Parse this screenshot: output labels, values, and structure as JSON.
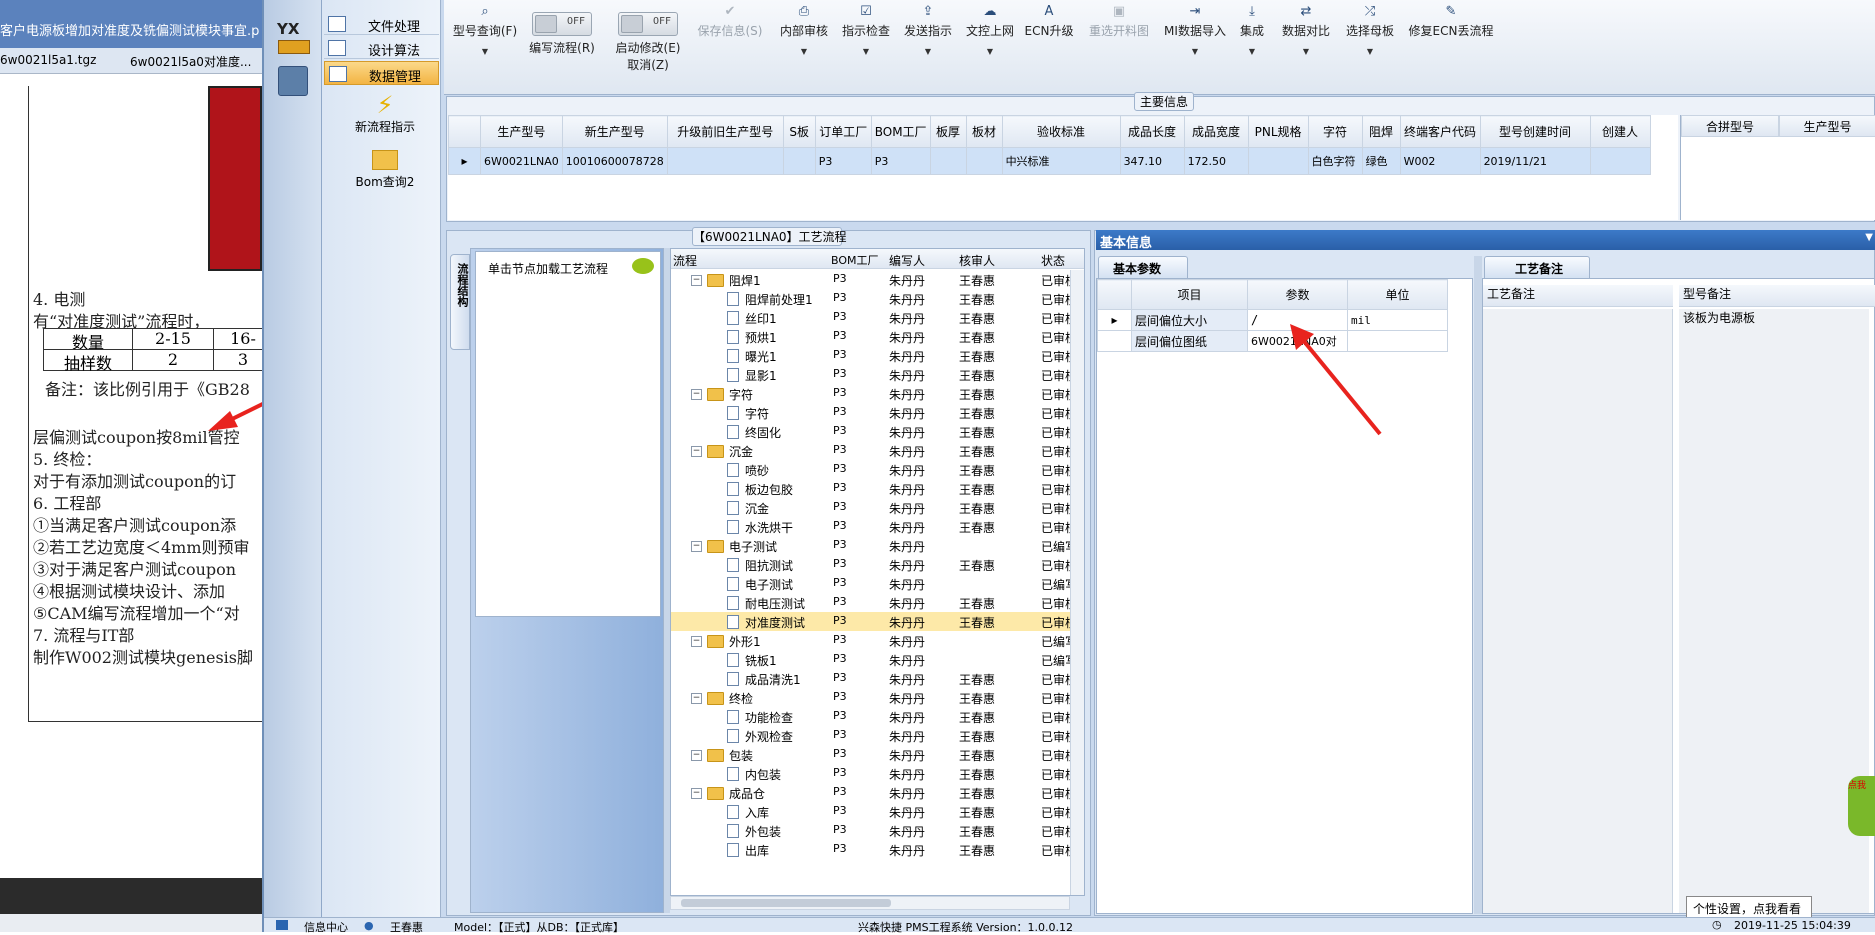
{
  "background_doc": {
    "title": "客户电源板增加对准度及铣偏测试模块事宜.p",
    "tabs": [
      "6w0021l5a1.tgz",
      "6w0021l5a0对准度..."
    ],
    "lines": [
      "4. 电测",
      "有“对准度测试”流程时，",
      "备注：该比例引用于《GB28",
      "层偏测试coupon按8mil管控",
      "5. 终检：",
      "对于有添加测试coupon的订",
      "6. 工程部",
      "①当满足客户测试coupon添",
      "②若工艺边宽度＜4mm则预审",
      "③对于满足客户测试coupon",
      "④根据测试模块设计、添加",
      "⑤CAM编写流程增加一个“对",
      "7. 流程与IT部",
      "制作W002测试模块genesis脚"
    ],
    "table": {
      "row1": [
        "数量",
        "2-15",
        "16-"
      ],
      "row2": [
        "抽样数",
        "2",
        "3"
      ]
    }
  },
  "nav": {
    "logo": "YX",
    "menu": [
      "文件处理",
      "设计算法",
      "数据管理"
    ],
    "actions": [
      "新流程指示",
      "Bom查询2"
    ]
  },
  "toolbar": {
    "buttons": [
      {
        "label": "型号查询(F)",
        "icon": "search-icon",
        "icon_glyph": "⌕",
        "disabled": false,
        "dropdown": true
      },
      {
        "label": "编写流程(R)",
        "icon": "toggle",
        "toggle_text": "OFF",
        "disabled": false,
        "dropdown": false
      },
      {
        "label": "启动修改(E)",
        "label2": "取消(Z)",
        "icon": "toggle",
        "toggle_text": "OFF",
        "disabled": false,
        "dropdown": false
      },
      {
        "label": "保存信息(S)",
        "icon": "check-icon",
        "icon_glyph": "✔",
        "disabled": true,
        "dropdown": false
      },
      {
        "label": "内部审核",
        "icon": "printer-icon",
        "icon_glyph": "⎙",
        "disabled": false,
        "dropdown": true
      },
      {
        "label": "指示检查",
        "icon": "checkbox-icon",
        "icon_glyph": "☑",
        "disabled": false,
        "dropdown": true
      },
      {
        "label": "发送指示",
        "icon": "upload-icon",
        "icon_glyph": "⇪",
        "disabled": false,
        "dropdown": true
      },
      {
        "label": "文控上网",
        "icon": "cloud-upload-icon",
        "icon_glyph": "☁",
        "disabled": false,
        "dropdown": true
      },
      {
        "label": "ECN升级",
        "icon": "font-icon",
        "icon_glyph": "A",
        "disabled": false,
        "dropdown": false
      },
      {
        "label": "重选开料图",
        "icon": "image-icon",
        "icon_glyph": "▣",
        "disabled": true,
        "dropdown": false
      },
      {
        "label": "MI数据导入",
        "icon": "import-icon",
        "icon_glyph": "⇥",
        "disabled": false,
        "dropdown": true
      },
      {
        "label": "集成",
        "icon": "download-icon",
        "icon_glyph": "⤓",
        "disabled": false,
        "dropdown": true
      },
      {
        "label": "数据对比",
        "icon": "compare-icon",
        "icon_glyph": "⇄",
        "disabled": false,
        "dropdown": true
      },
      {
        "label": "选择母板",
        "icon": "shuffle-icon",
        "icon_glyph": "⤮",
        "disabled": false,
        "dropdown": true
      },
      {
        "label": "修复ECN丢流程",
        "icon": "wrench-icon",
        "icon_glyph": "✎",
        "disabled": false,
        "dropdown": false
      }
    ]
  },
  "main_info": {
    "title": "主要信息",
    "columns": [
      "生产型号",
      "新生产型号",
      "升级前旧生产型号",
      "S板",
      "订单工厂",
      "BOM工厂",
      "板厚",
      "板材",
      "验收标准",
      "成品长度",
      "成品宽度",
      "PNL规格",
      "字符",
      "阻焊",
      "终端客户代码",
      "型号创建时间",
      "创建人"
    ],
    "row": [
      "6W0021LNA0",
      "10010600078728",
      "",
      "",
      "P3",
      "P3",
      "",
      "",
      "中兴标准",
      "347.10",
      "172.50",
      "",
      "白色字符",
      "绿色",
      "W002",
      "2019/11/21",
      ""
    ],
    "side_columns": [
      "合拼型号",
      "生产型号"
    ]
  },
  "flow_panel": {
    "title": "【6W0021LNA0】工艺流程",
    "side_tab": "流程结构",
    "load_hint": "单击节点加载工艺流程",
    "columns": [
      "流程",
      "BOM工厂",
      "编写人",
      "核审人",
      "状态"
    ],
    "rows": [
      {
        "level": 0,
        "name": "阻焊1",
        "bom": "P3",
        "writer": "朱丹丹",
        "reviewer": "王春惠",
        "status": "已审核"
      },
      {
        "level": 1,
        "name": "阻焊前处理1",
        "bom": "P3",
        "writer": "朱丹丹",
        "reviewer": "王春惠",
        "status": "已审核"
      },
      {
        "level": 1,
        "name": "丝印1",
        "bom": "P3",
        "writer": "朱丹丹",
        "reviewer": "王春惠",
        "status": "已审核"
      },
      {
        "level": 1,
        "name": "预烘1",
        "bom": "P3",
        "writer": "朱丹丹",
        "reviewer": "王春惠",
        "status": "已审核"
      },
      {
        "level": 1,
        "name": "曝光1",
        "bom": "P3",
        "writer": "朱丹丹",
        "reviewer": "王春惠",
        "status": "已审核"
      },
      {
        "level": 1,
        "name": "显影1",
        "bom": "P3",
        "writer": "朱丹丹",
        "reviewer": "王春惠",
        "status": "已审核"
      },
      {
        "level": 0,
        "name": "字符",
        "bom": "P3",
        "writer": "朱丹丹",
        "reviewer": "王春惠",
        "status": "已审核"
      },
      {
        "level": 1,
        "name": "字符",
        "bom": "P3",
        "writer": "朱丹丹",
        "reviewer": "王春惠",
        "status": "已审核"
      },
      {
        "level": 1,
        "name": "终固化",
        "bom": "P3",
        "writer": "朱丹丹",
        "reviewer": "王春惠",
        "status": "已审核"
      },
      {
        "level": 0,
        "name": "沉金",
        "bom": "P3",
        "writer": "朱丹丹",
        "reviewer": "王春惠",
        "status": "已审核"
      },
      {
        "level": 1,
        "name": "喷砂",
        "bom": "P3",
        "writer": "朱丹丹",
        "reviewer": "王春惠",
        "status": "已审核"
      },
      {
        "level": 1,
        "name": "板边包胶",
        "bom": "P3",
        "writer": "朱丹丹",
        "reviewer": "王春惠",
        "status": "已审核"
      },
      {
        "level": 1,
        "name": "沉金",
        "bom": "P3",
        "writer": "朱丹丹",
        "reviewer": "王春惠",
        "status": "已审核"
      },
      {
        "level": 1,
        "name": "水洗烘干",
        "bom": "P3",
        "writer": "朱丹丹",
        "reviewer": "王春惠",
        "status": "已审核"
      },
      {
        "level": 0,
        "name": "电子测试",
        "bom": "P3",
        "writer": "朱丹丹",
        "reviewer": "",
        "status": "已编写"
      },
      {
        "level": 1,
        "name": "阻抗测试",
        "bom": "P3",
        "writer": "朱丹丹",
        "reviewer": "王春惠",
        "status": "已审核"
      },
      {
        "level": 1,
        "name": "电子测试",
        "bom": "P3",
        "writer": "朱丹丹",
        "reviewer": "",
        "status": "已编写"
      },
      {
        "level": 1,
        "name": "耐电压测试",
        "bom": "P3",
        "writer": "朱丹丹",
        "reviewer": "王春惠",
        "status": "已审核"
      },
      {
        "level": 1,
        "name": "对准度测试",
        "bom": "P3",
        "writer": "朱丹丹",
        "reviewer": "王春惠",
        "status": "已审核",
        "highlight": true
      },
      {
        "level": 0,
        "name": "外形1",
        "bom": "P3",
        "writer": "朱丹丹",
        "reviewer": "",
        "status": "已编写"
      },
      {
        "level": 1,
        "name": "铣板1",
        "bom": "P3",
        "writer": "朱丹丹",
        "reviewer": "",
        "status": "已编写"
      },
      {
        "level": 1,
        "name": "成品清洗1",
        "bom": "P3",
        "writer": "朱丹丹",
        "reviewer": "王春惠",
        "status": "已审核"
      },
      {
        "level": 0,
        "name": "终检",
        "bom": "P3",
        "writer": "朱丹丹",
        "reviewer": "王春惠",
        "status": "已审核"
      },
      {
        "level": 1,
        "name": "功能检查",
        "bom": "P3",
        "writer": "朱丹丹",
        "reviewer": "王春惠",
        "status": "已审核"
      },
      {
        "level": 1,
        "name": "外观检查",
        "bom": "P3",
        "writer": "朱丹丹",
        "reviewer": "王春惠",
        "status": "已审核"
      },
      {
        "level": 0,
        "name": "包装",
        "bom": "P3",
        "writer": "朱丹丹",
        "reviewer": "王春惠",
        "status": "已审核"
      },
      {
        "level": 1,
        "name": "内包装",
        "bom": "P3",
        "writer": "朱丹丹",
        "reviewer": "王春惠",
        "status": "已审核"
      },
      {
        "level": 0,
        "name": "成品仓",
        "bom": "P3",
        "writer": "朱丹丹",
        "reviewer": "王春惠",
        "status": "已审核"
      },
      {
        "level": 1,
        "name": "入库",
        "bom": "P3",
        "writer": "朱丹丹",
        "reviewer": "王春惠",
        "status": "已审核"
      },
      {
        "level": 1,
        "name": "外包装",
        "bom": "P3",
        "writer": "朱丹丹",
        "reviewer": "王春惠",
        "status": "已审核"
      },
      {
        "level": 1,
        "name": "出库",
        "bom": "P3",
        "writer": "朱丹丹",
        "reviewer": "王春惠",
        "status": "已审核"
      }
    ]
  },
  "basic_info": {
    "title": "基本信息",
    "tab": "基本参数",
    "columns": [
      "项目",
      "参数",
      "单位"
    ],
    "rows": [
      {
        "item": "层间偏位大小",
        "param": "/",
        "unit": "mil"
      },
      {
        "item": "层间偏位图纸",
        "param": "6W0021LNA0对",
        "unit": ""
      }
    ]
  },
  "remarks": {
    "tab": "工艺备注",
    "columns": [
      "工艺备注",
      "型号备注"
    ],
    "model_remark": "该板为电源板"
  },
  "tooltip": "个性设置，点我看看",
  "badge": "点我",
  "status_bar": {
    "info": "信息中心",
    "user": "王春惠",
    "mode": "Model：【正式】从DB：【正式库】",
    "system": "兴森快捷 PMS工程系统 Version：1.0.0.12",
    "time": "2019-11-25 15:04:39"
  },
  "colors": {
    "accent": "#2a65b0",
    "panel": "#dbe6f4",
    "highlight": "#fde9a8",
    "annotation_arrow": "#e8231e"
  }
}
